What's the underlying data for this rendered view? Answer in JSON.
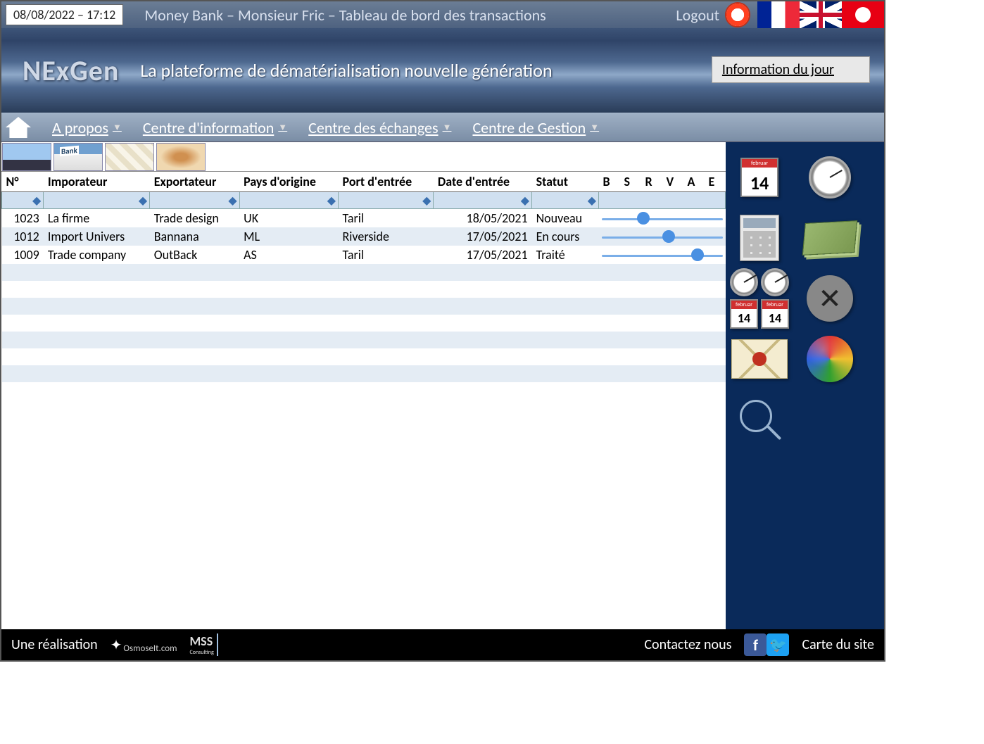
{
  "topbar": {
    "datetime": "08/08/2022 – 17:12",
    "title": "Money Bank – Monsieur Fric – Tableau de bord des transactions",
    "logout": "Logout"
  },
  "hero": {
    "brand": "NExGen",
    "tagline": "La plateforme de dématérialisation nouvelle génération",
    "info_day": "Information du jour"
  },
  "nav": {
    "about": "A propos",
    "info_center": "Centre d'information",
    "exchange_center": "Centre des échanges",
    "mgmt_center": "Centre de Gestion"
  },
  "table": {
    "headers": {
      "num": "N°",
      "importer": "Imporateur",
      "exporter": "Exportateur",
      "origin": "Pays d'origine",
      "port": "Port d'entrée",
      "entry_date": "Date d'entrée",
      "status": "Statut",
      "b": "B",
      "s": "S",
      "r": "R",
      "v": "V",
      "a": "A",
      "e": "E"
    },
    "rows": [
      {
        "num": "1023",
        "importer": "La firme",
        "exporter": "Trade design",
        "origin": "UK",
        "port": "Taril",
        "date": "18/05/2021",
        "status": "Nouveau",
        "slider": 35
      },
      {
        "num": "1012",
        "importer": "Import Univers",
        "exporter": "Bannana",
        "origin": "ML",
        "port": "Riverside",
        "date": "17/05/2021",
        "status": "En cours",
        "slider": 55
      },
      {
        "num": "1009",
        "importer": "Trade company",
        "exporter": "OutBack",
        "origin": "AS",
        "port": "Taril",
        "date": "17/05/2021",
        "status": "Traité",
        "slider": 78
      }
    ]
  },
  "footer": {
    "made_by": "Une réalisation",
    "osmose": "OsmoseIt.com",
    "mss": "MSS",
    "mss_sub": "Consulting",
    "contact": "Contactez nous",
    "sitemap": "Carte du site"
  }
}
